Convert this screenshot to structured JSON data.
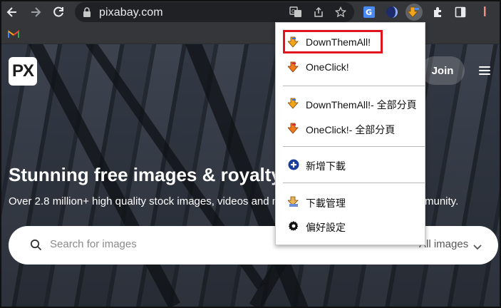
{
  "browser": {
    "url": "pixabay.com",
    "toolbar_icons": [
      "back-arrow-icon",
      "forward-arrow-icon",
      "reload-icon",
      "lock-icon",
      "translate-icon",
      "share-icon",
      "star-icon"
    ],
    "extension_icons": [
      "google-translate-extension-icon",
      "dark-circle-extension-icon",
      "downthemall-extension-icon",
      "puzzle-extensions-icon",
      "side-panel-icon",
      "profile-menu-icon"
    ],
    "bookmark_icon": "gmail-icon"
  },
  "page": {
    "logo_text": "PX",
    "join_label": "Join",
    "hero_title": "Stunning free images & royalty",
    "hero_subtitle": "Over 2.8 million+ high quality stock images, videos and mu",
    "hero_subtitle_end": "munity.",
    "search_placeholder": "Search for images",
    "search_filter": "All images"
  },
  "menu": {
    "items": [
      {
        "label": "DownThemAll!",
        "icon": "downthemall-arrow-icon",
        "highlighted": true
      },
      {
        "label": "OneClick!",
        "icon": "oneclick-arrow-icon"
      },
      {
        "label": "DownThemAll!- 全部分頁",
        "icon": "downthemall-arrow-icon"
      },
      {
        "label": "OneClick!- 全部分頁",
        "icon": "oneclick-arrow-icon"
      },
      {
        "label": "新增下載",
        "icon": "plus-circle-icon"
      },
      {
        "label": "下載管理",
        "icon": "download-manager-icon"
      },
      {
        "label": "偏好設定",
        "icon": "gear-icon"
      }
    ]
  },
  "colors": {
    "toolbar_bg": "#35363a",
    "omnibox_bg": "#202124",
    "highlight_border": "#e0141e",
    "plus_icon_blue": "#1a3e9e"
  }
}
